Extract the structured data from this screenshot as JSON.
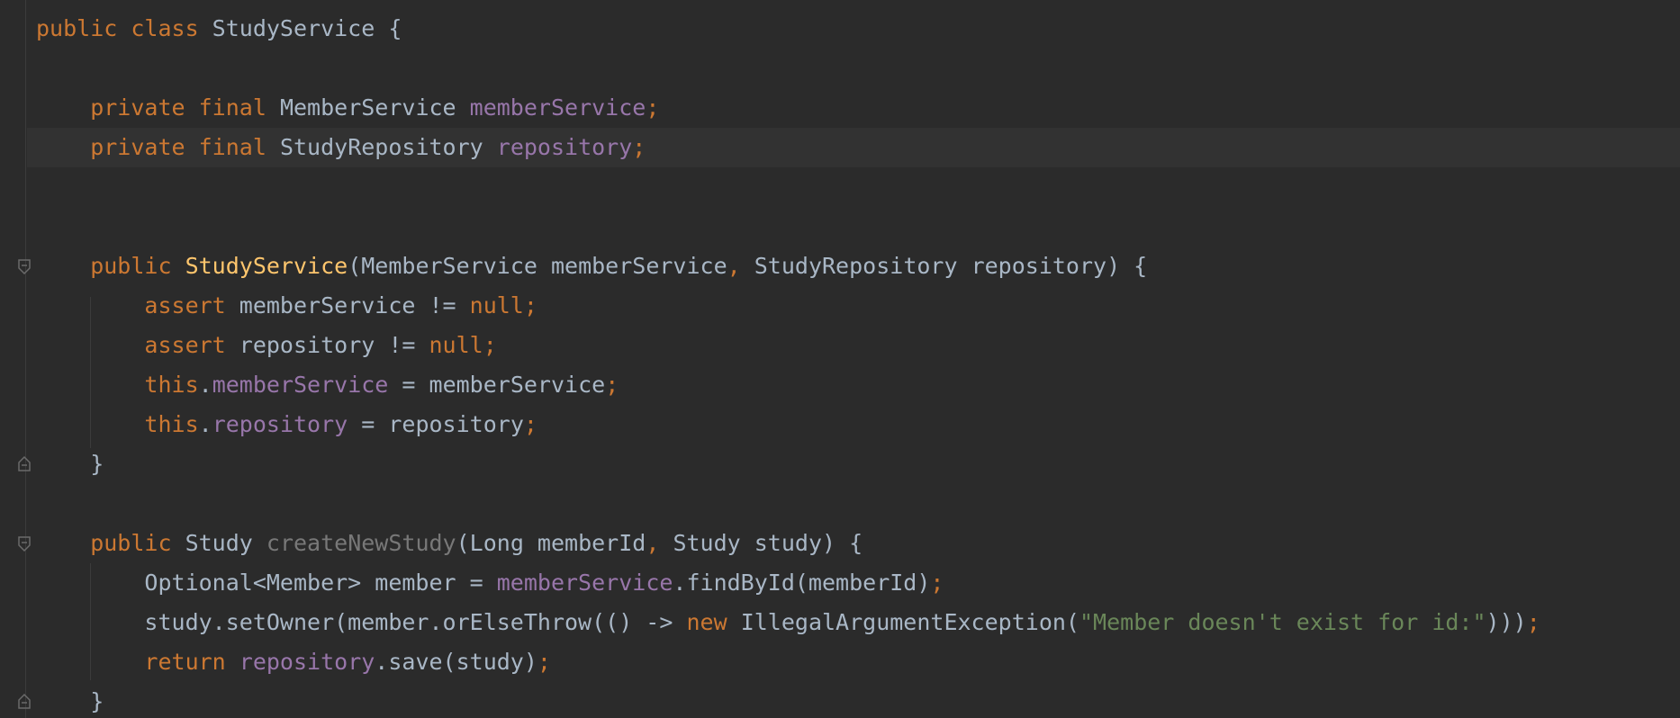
{
  "editor": {
    "language": "java",
    "colors": {
      "background": "#2b2b2b",
      "current_line": "#323232",
      "keyword": "#cc7832",
      "field": "#9876aa",
      "method_declaration": "#ffc66d",
      "unused_method": "#787878",
      "string": "#6a8759",
      "text": "#a9b7c6"
    },
    "fold_icons": [
      "fold-open-icon",
      "fold-close-icon"
    ],
    "lines": [
      [
        {
          "t": "public class ",
          "k": "kw"
        },
        {
          "t": "StudyService {",
          "k": "plain"
        }
      ],
      [],
      [
        {
          "t": "    private final ",
          "k": "kw"
        },
        {
          "t": "MemberService ",
          "k": "plain"
        },
        {
          "t": "memberService",
          "k": "field"
        },
        {
          "t": ";",
          "k": "punct"
        }
      ],
      [
        {
          "t": "    private final ",
          "k": "kw"
        },
        {
          "t": "StudyRepository ",
          "k": "plain"
        },
        {
          "t": "repository",
          "k": "field"
        },
        {
          "t": ";",
          "k": "punct"
        }
      ],
      [],
      [],
      [
        {
          "t": "    public ",
          "k": "kw"
        },
        {
          "t": "StudyService",
          "k": "fn-decl"
        },
        {
          "t": "(MemberService memberService",
          "k": "plain"
        },
        {
          "t": ", ",
          "k": "punct"
        },
        {
          "t": "StudyRepository repository) {",
          "k": "plain"
        }
      ],
      [
        {
          "t": "        assert ",
          "k": "kw"
        },
        {
          "t": "memberService != ",
          "k": "plain"
        },
        {
          "t": "null;",
          "k": "kw"
        }
      ],
      [
        {
          "t": "        assert ",
          "k": "kw"
        },
        {
          "t": "repository != ",
          "k": "plain"
        },
        {
          "t": "null;",
          "k": "kw"
        }
      ],
      [
        {
          "t": "        this",
          "k": "kw"
        },
        {
          "t": ".",
          "k": "plain"
        },
        {
          "t": "memberService",
          "k": "field"
        },
        {
          "t": " = memberService",
          "k": "plain"
        },
        {
          "t": ";",
          "k": "punct"
        }
      ],
      [
        {
          "t": "        this",
          "k": "kw"
        },
        {
          "t": ".",
          "k": "plain"
        },
        {
          "t": "repository",
          "k": "field"
        },
        {
          "t": " = repository",
          "k": "plain"
        },
        {
          "t": ";",
          "k": "punct"
        }
      ],
      [
        {
          "t": "    }",
          "k": "plain"
        }
      ],
      [],
      [
        {
          "t": "    public ",
          "k": "kw"
        },
        {
          "t": "Study ",
          "k": "plain"
        },
        {
          "t": "createNewStudy",
          "k": "fn-unused"
        },
        {
          "t": "(Long memberId",
          "k": "plain"
        },
        {
          "t": ", ",
          "k": "punct"
        },
        {
          "t": "Study study) {",
          "k": "plain"
        }
      ],
      [
        {
          "t": "        Optional<Member> member = ",
          "k": "plain"
        },
        {
          "t": "memberService",
          "k": "field"
        },
        {
          "t": ".findById(memberId)",
          "k": "plain"
        },
        {
          "t": ";",
          "k": "punct"
        }
      ],
      [
        {
          "t": "        study.setOwner(member.orElseThrow(() -> ",
          "k": "plain"
        },
        {
          "t": "new ",
          "k": "kw"
        },
        {
          "t": "IllegalArgumentException(",
          "k": "plain"
        },
        {
          "t": "\"Member doesn't exist for id:\"",
          "k": "str"
        },
        {
          "t": ")))",
          "k": "plain"
        },
        {
          "t": ";",
          "k": "punct"
        }
      ],
      [
        {
          "t": "        return ",
          "k": "kw"
        },
        {
          "t": "repository",
          "k": "field"
        },
        {
          "t": ".save(study)",
          "k": "plain"
        },
        {
          "t": ";",
          "k": "punct"
        }
      ],
      [
        {
          "t": "    }",
          "k": "plain"
        }
      ]
    ]
  }
}
